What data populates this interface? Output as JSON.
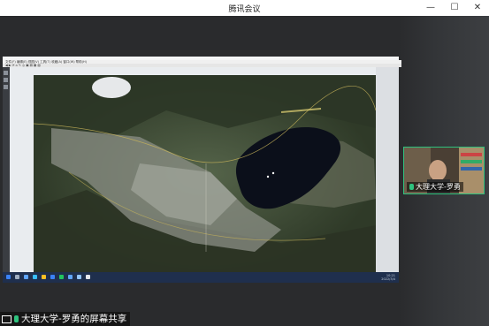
{
  "window": {
    "title": "腾讯会议",
    "controls": {
      "minimize": "—",
      "maximize": "☐",
      "close": "✕"
    }
  },
  "shared_screen": {
    "menu": "文件(F)  编辑(E)  视图(V)  工具(T)  收藏(A)  窗口(W)  帮助(H)",
    "toolbar": "◀ ▶ ⟳ ⌂ ✎ ◎ ▣ ▤ ▦ ▧",
    "taskbar_time": "10:21",
    "taskbar_date": "2022/3/4"
  },
  "participant": {
    "name": "大理大学-罗勇"
  },
  "share_label": "大理大学-罗勇的屏幕共享",
  "colors": {
    "active_speaker_border": "#2ec27e",
    "lake": "#0b0f1a"
  },
  "icons": [
    "screen-share-icon",
    "microphone-icon",
    "minimize-icon",
    "maximize-icon",
    "close-icon"
  ]
}
